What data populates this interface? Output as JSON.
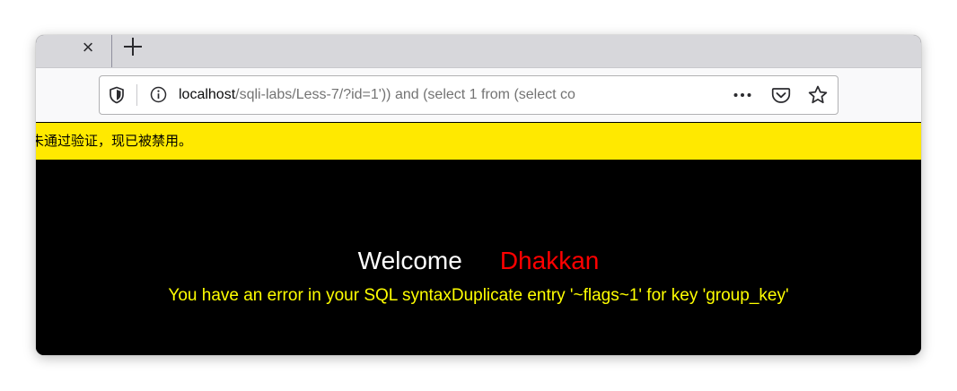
{
  "browser": {
    "tab_close_glyph": "×",
    "new_tab_glyph": "+",
    "url": {
      "host": "localhost",
      "rest": "/sqli-labs/Less-7/?id=1')) and (select 1 from (select co"
    },
    "toolbar_icons": [
      "shield-icon",
      "info-icon",
      "more-icon",
      "pocket-icon",
      "star-icon"
    ]
  },
  "notification": {
    "text": "未通过验证，现已被禁用。",
    "background": "#ffe900"
  },
  "page": {
    "welcome_label": "Welcome",
    "username": "Dhakkan",
    "error_message": "You have an error in your SQL syntaxDuplicate entry '~flags~1' for key 'group_key'"
  },
  "colors": {
    "page_background": "#000000",
    "welcome": "#ffffff",
    "username": "#ff0000",
    "error": "#ffff00"
  }
}
